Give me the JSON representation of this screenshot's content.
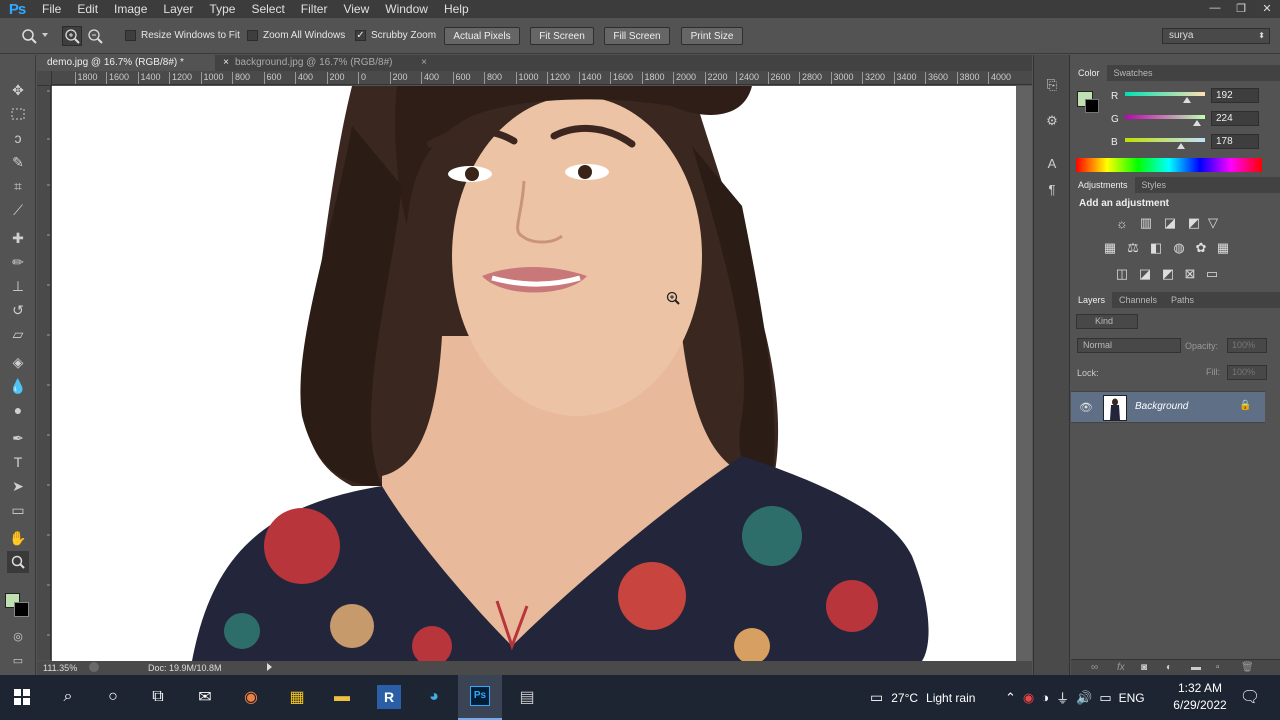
{
  "app": {
    "logo": "Ps"
  },
  "menu": [
    "File",
    "Edit",
    "Image",
    "Layer",
    "Type",
    "Select",
    "Filter",
    "View",
    "Window",
    "Help"
  ],
  "window_controls": {
    "minimize": "—",
    "restore": "❐",
    "close": "✕"
  },
  "options": {
    "resize_windows": "Resize Windows to Fit",
    "zoom_all": "Zoom All Windows",
    "scrubby_zoom": "Scrubby Zoom",
    "actual_pixels": "Actual Pixels",
    "fit_screen": "Fit Screen",
    "fill_screen": "Fill Screen",
    "print_size": "Print Size",
    "workspace": "surya"
  },
  "tabs": [
    {
      "label": "demo.jpg @ 16.7% (RGB/8#) *",
      "close": "×"
    },
    {
      "label": "background.jpg @ 16.7% (RGB/8#)",
      "close": "×"
    }
  ],
  "ruler_h": [
    "0",
    "1800",
    "1600",
    "1400",
    "1200",
    "1000",
    "800",
    "600",
    "400",
    "200",
    "0",
    "200",
    "400",
    "600",
    "800",
    "1000",
    "1200",
    "1400",
    "1600",
    "1800",
    "2000",
    "2200",
    "2400",
    "2600",
    "2800",
    "3000",
    "3200",
    "3400",
    "3600",
    "3800",
    "4000"
  ],
  "status": {
    "zoom": "111.35%",
    "doc": "Doc: 19.9M/10.8M"
  },
  "color_panel": {
    "tabs": [
      "Color",
      "Swatches"
    ],
    "fg_color": "#c0e0b2",
    "r": {
      "label": "R",
      "value": "192"
    },
    "g": {
      "label": "G",
      "value": "224"
    },
    "b": {
      "label": "B",
      "value": "178"
    }
  },
  "adjustments_panel": {
    "tabs": [
      "Adjustments",
      "Styles"
    ],
    "heading": "Add an adjustment"
  },
  "layers_panel": {
    "tabs": [
      "Layers",
      "Channels",
      "Paths"
    ],
    "kind": "Kind",
    "blend_mode": "Normal",
    "opacity_label": "Opacity:",
    "opacity_value": "100%",
    "lock_label": "Lock:",
    "fill_label": "Fill:",
    "fill_value": "100%",
    "layer_name": "Background"
  },
  "taskbar": {
    "weather_temp": "27°C",
    "weather_desc": "Light rain",
    "lang": "ENG",
    "time": "1:32 AM",
    "date": "6/29/2022"
  }
}
